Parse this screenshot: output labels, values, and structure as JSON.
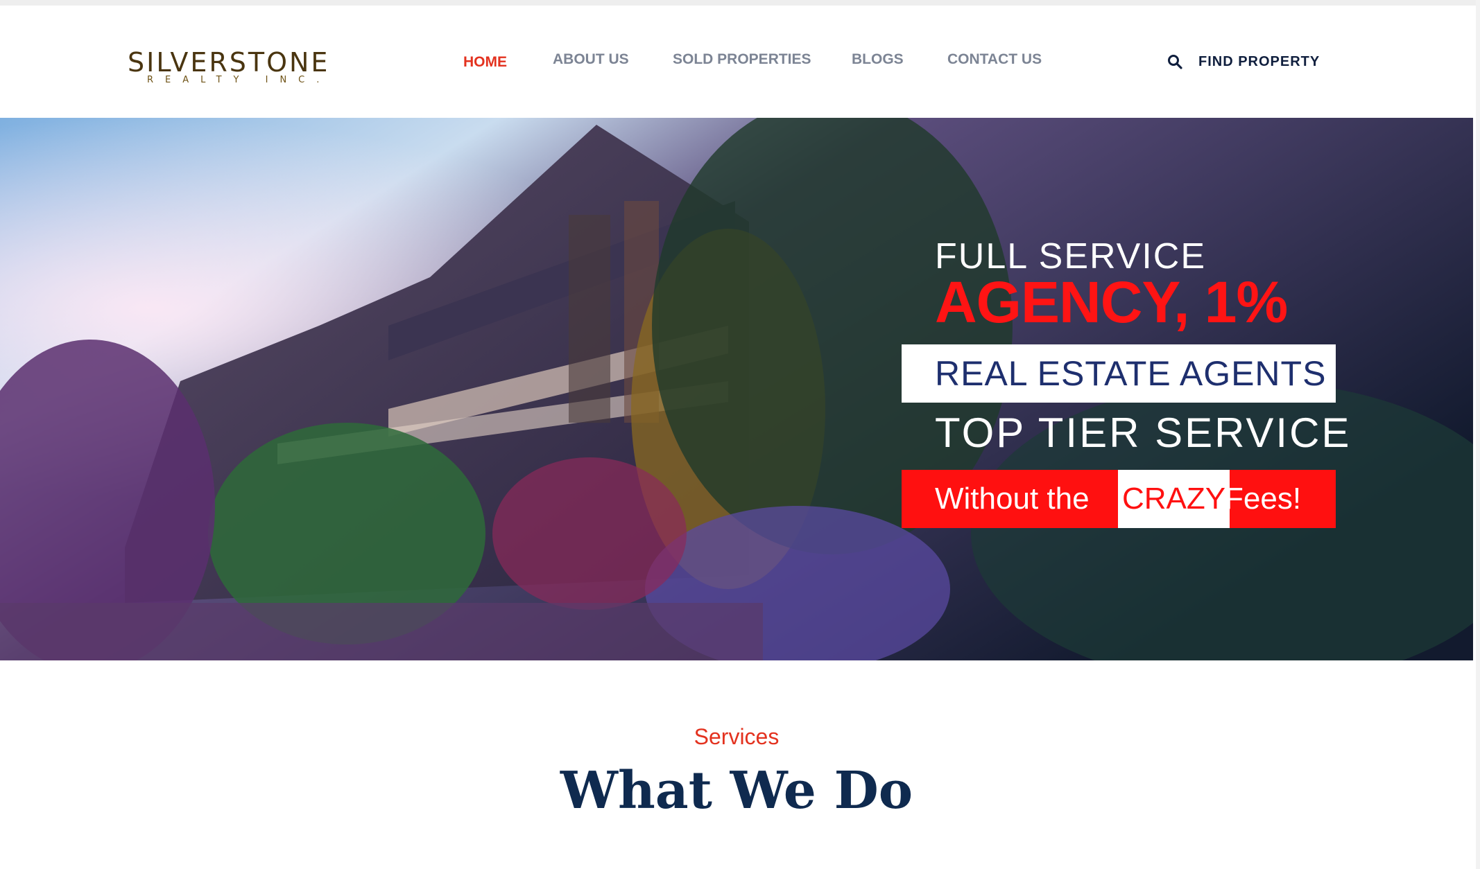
{
  "logo": {
    "name": "SILVERSTONE",
    "subtitle": "REALTY INC."
  },
  "nav": {
    "items": [
      {
        "label": "HOME",
        "active": true
      },
      {
        "label": "ABOUT US",
        "active": false
      },
      {
        "label": "SOLD PROPERTIES",
        "active": false
      },
      {
        "label": "BLOGS",
        "active": false
      },
      {
        "label": "CONTACT US",
        "active": false
      }
    ],
    "find_property": "FIND PROPERTY",
    "search_icon": "search-icon"
  },
  "hero": {
    "line1": "FULL SERVICE",
    "line2": "AGENCY, 1%",
    "line3": "REAL ESTATE AGENTS",
    "line4": "TOP  TIER SERVICE",
    "line5_part1": "Without the",
    "line5_part2": "CRAZY",
    "line5_part3": "Fees!"
  },
  "services": {
    "label": "Services",
    "title": "What We Do"
  },
  "colors": {
    "accent": "#e3321f",
    "navy": "#0f2a4f",
    "hero_red": "#ff1010"
  }
}
